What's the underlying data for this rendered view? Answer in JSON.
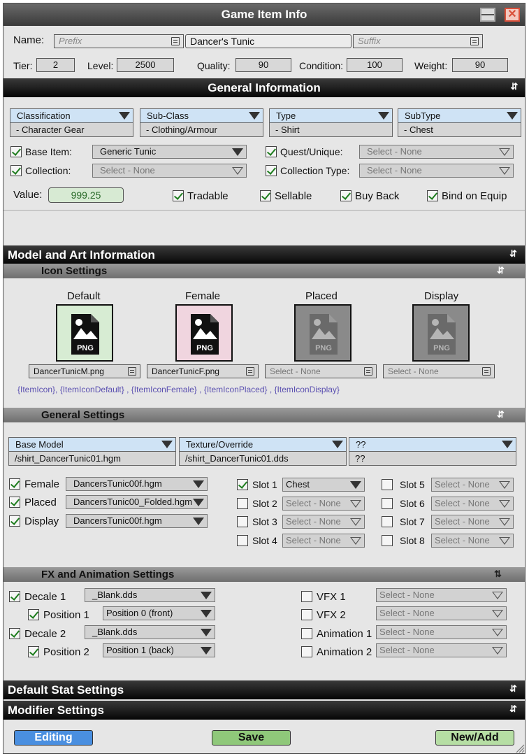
{
  "window": {
    "title": "Game Item Info"
  },
  "name_row": {
    "label": "Name:",
    "prefix_placeholder": "Prefix",
    "name_value": "Dancer's Tunic",
    "suffix_placeholder": "Suffix"
  },
  "stats_row": [
    {
      "label": "Tier:",
      "value": "2"
    },
    {
      "label": "Level:",
      "value": "2500"
    },
    {
      "label": "Quality:",
      "value": "90"
    },
    {
      "label": "Condition:",
      "value": "100"
    },
    {
      "label": "Weight:",
      "value": "90"
    }
  ],
  "general_info": {
    "title": "General Information",
    "headers": [
      {
        "label": "Classification",
        "value": "- Character Gear"
      },
      {
        "label": "Sub-Class",
        "value": "- Clothing/Armour"
      },
      {
        "label": "Type",
        "value": "- Shirt"
      },
      {
        "label": "SubType",
        "value": "- Chest"
      }
    ],
    "base_item": {
      "label": "Base Item:",
      "value": "Generic Tunic",
      "checked": true
    },
    "quest_unique": {
      "label": "Quest/Unique:",
      "value": "Select - None",
      "checked": true
    },
    "collection": {
      "label": "Collection:",
      "value": "Select - None",
      "checked": true
    },
    "collection_type": {
      "label": "Collection Type:",
      "value": "Select - None",
      "checked": true
    },
    "value_label": "Value:",
    "value": "999.25",
    "flags": [
      {
        "label": "Tradable",
        "checked": true
      },
      {
        "label": "Sellable",
        "checked": true
      },
      {
        "label": "Buy Back",
        "checked": true
      },
      {
        "label": "Bind on Equip",
        "checked": true
      }
    ]
  },
  "model_art": {
    "title": "Model and Art Information",
    "icon_settings": {
      "title": "Icon Settings",
      "icons": [
        {
          "label": "Default",
          "file": "DancerTunicM.png",
          "badge": "PNG",
          "bg": "#d7ecd3",
          "active": true
        },
        {
          "label": "Female",
          "file": "DancerTunicF.png",
          "badge": "PNG",
          "bg": "#f0d5df",
          "active": true
        },
        {
          "label": "Placed",
          "file": "Select - None",
          "badge": "PNG",
          "bg": "#8a8a8a",
          "active": false
        },
        {
          "label": "Display",
          "file": "Select - None",
          "badge": "PNG",
          "bg": "#8a8a8a",
          "active": false
        }
      ],
      "tokens": "{ItemIcon}, {ItemIconDefault} , {ItemIconFemale} , {ItemIconPlaced} , {ItemIconDisplay}"
    },
    "general_settings": {
      "title": "General Settings",
      "headers": [
        {
          "label": "Base Model",
          "value": "/shirt_DancerTunic01.hgm"
        },
        {
          "label": "Texture/Override",
          "value": "/shirt_DancerTunic01.dds"
        },
        {
          "label": "??",
          "value": "??"
        }
      ],
      "variants": [
        {
          "label": "Female",
          "value": "DancersTunic00f.hgm",
          "checked": true
        },
        {
          "label": "Placed",
          "value": "DancersTunic00_Folded.hgm",
          "checked": true
        },
        {
          "label": "Display",
          "value": "DancersTunic00f.hgm",
          "checked": true
        }
      ],
      "slots": [
        {
          "label": "Slot 1",
          "value": "Chest",
          "checked": true
        },
        {
          "label": "Slot 2",
          "value": "Select - None",
          "checked": false
        },
        {
          "label": "Slot 3",
          "value": "Select - None",
          "checked": false
        },
        {
          "label": "Slot 4",
          "value": "Select - None",
          "checked": false
        },
        {
          "label": "Slot 5",
          "value": "Select - None",
          "checked": false
        },
        {
          "label": "Slot 6",
          "value": "Select - None",
          "checked": false
        },
        {
          "label": "Slot 7",
          "value": "Select - None",
          "checked": false
        },
        {
          "label": "Slot 8",
          "value": "Select - None",
          "checked": false
        }
      ]
    },
    "fx_settings": {
      "title": "FX and Animation Settings",
      "left": [
        {
          "label": "Decale 1",
          "value": "_Blank.dds",
          "checked": true
        },
        {
          "label": "Position 1",
          "value": "Position 0 (front)",
          "checked": true
        },
        {
          "label": "Decale 2",
          "value": "_Blank.dds",
          "checked": true
        },
        {
          "label": "Position 2",
          "value": "Position 1 (back)",
          "checked": true
        }
      ],
      "right": [
        {
          "label": "VFX 1",
          "value": "Select - None",
          "checked": false
        },
        {
          "label": "VFX 2",
          "value": "Select - None",
          "checked": false
        },
        {
          "label": "Animation 1",
          "value": "Select - None",
          "checked": false
        },
        {
          "label": "Animation 2",
          "value": "Select - None",
          "checked": false
        }
      ]
    }
  },
  "default_stats": {
    "title": "Default Stat Settings"
  },
  "modifiers": {
    "title": "Modifier Settings"
  },
  "footer": {
    "editing_label": "Editing",
    "save_label": "Save",
    "new_label": "New/Add"
  },
  "colors": {
    "accent_blue": "#4a8fe0",
    "save_green": "#8fc87a",
    "header_blue": "#cfe3f5"
  }
}
